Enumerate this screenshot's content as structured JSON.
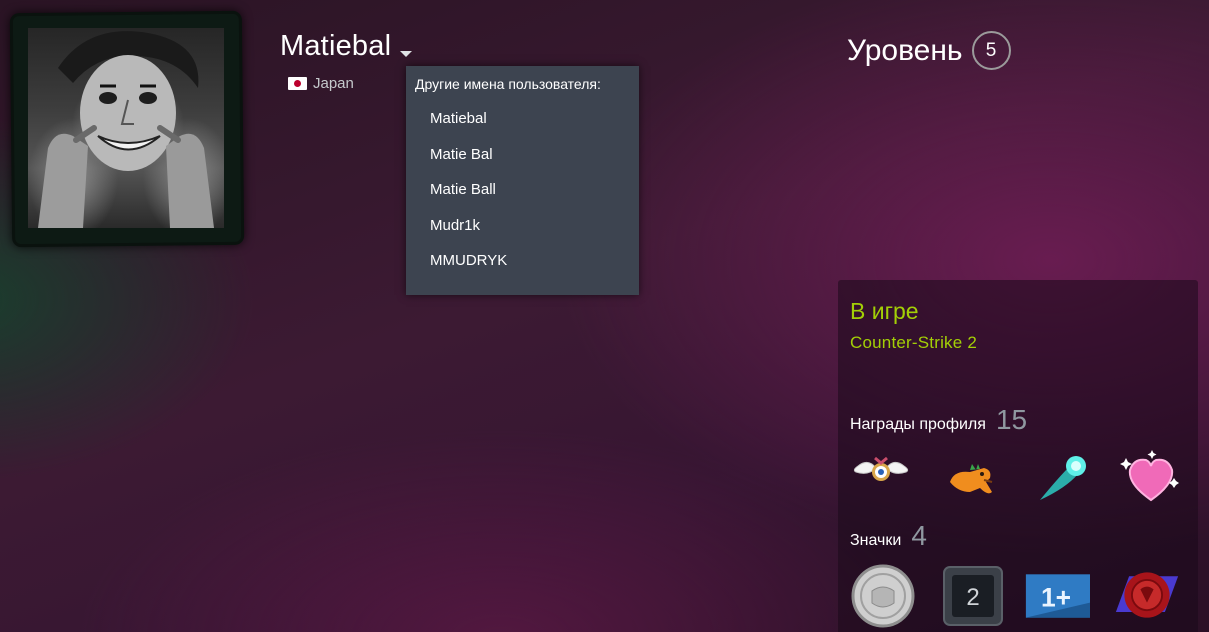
{
  "profile": {
    "username": "Matiebal",
    "country": "Japan"
  },
  "aliases": {
    "heading": "Другие имена пользователя:",
    "items": [
      "Matiebal",
      "Matie Bal",
      "Matie Ball",
      "Mudr1k",
      "MMUDRYK"
    ]
  },
  "level": {
    "label": "Уровень",
    "value": "5"
  },
  "status": {
    "title": "В игре",
    "game": "Counter-Strike 2"
  },
  "awards": {
    "label": "Награды профиля",
    "count": "15",
    "icons": [
      "winged-eye-award-icon",
      "dinosaur-award-icon",
      "comet-award-icon",
      "heart-award-icon"
    ]
  },
  "badges": {
    "label": "Значки",
    "count": "4",
    "icons": [
      "silver-coin-badge-icon",
      "years-badge-icon",
      "one-plus-badge-icon",
      "red-seal-badge-icon"
    ],
    "years_badge_number": "2",
    "one_plus_text": "1+"
  },
  "colors": {
    "status_green": "#a3cf06",
    "dropdown_bg": "#3d4450",
    "count_gray": "#8f98a0"
  }
}
